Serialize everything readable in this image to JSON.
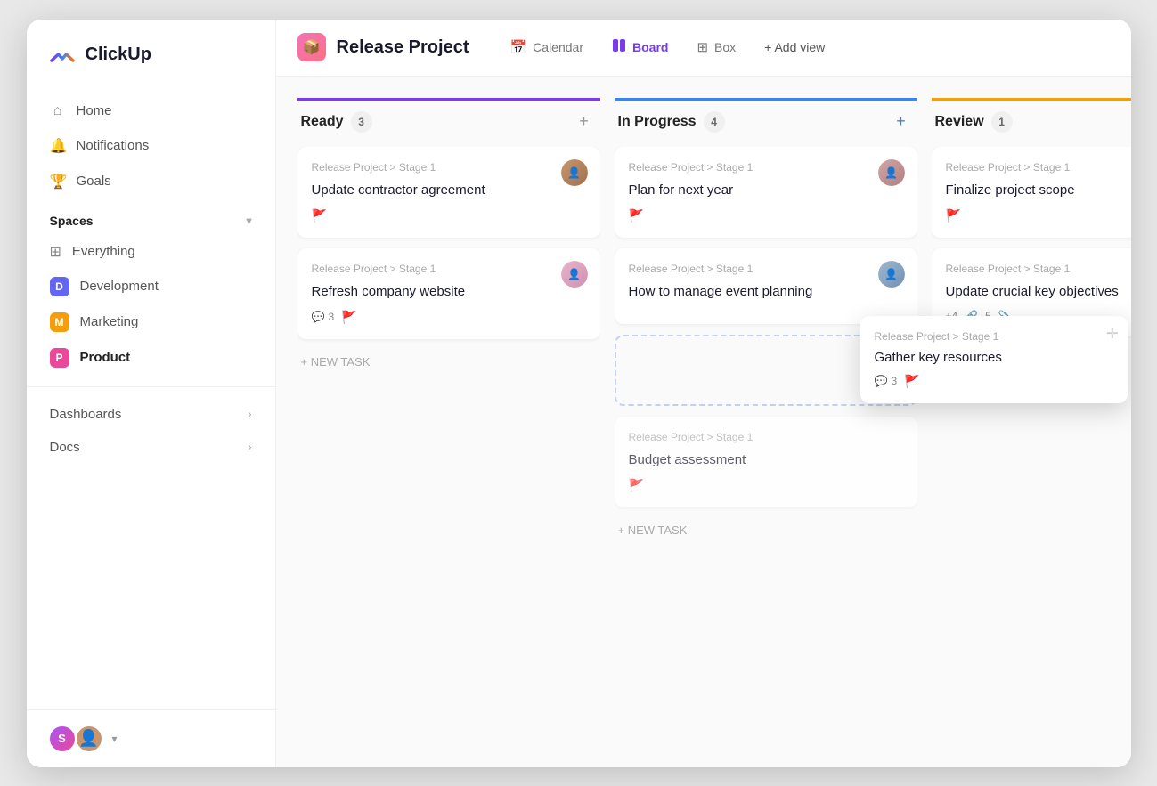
{
  "app": {
    "name": "ClickUp"
  },
  "sidebar": {
    "nav_items": [
      {
        "id": "home",
        "label": "Home",
        "icon": "🏠"
      },
      {
        "id": "notifications",
        "label": "Notifications",
        "icon": "🔔"
      },
      {
        "id": "goals",
        "label": "Goals",
        "icon": "🏆"
      }
    ],
    "spaces_title": "Spaces",
    "spaces": [
      {
        "id": "everything",
        "label": "Everything",
        "type": "everything"
      },
      {
        "id": "development",
        "label": "Development",
        "color": "#6366f1",
        "letter": "D"
      },
      {
        "id": "marketing",
        "label": "Marketing",
        "color": "#f59e0b",
        "letter": "M"
      },
      {
        "id": "product",
        "label": "Product",
        "color": "#ec4899",
        "letter": "P",
        "active": true
      }
    ],
    "collapse_items": [
      {
        "id": "dashboards",
        "label": "Dashboards"
      },
      {
        "id": "docs",
        "label": "Docs"
      }
    ]
  },
  "topbar": {
    "project_icon": "📦",
    "project_title": "Release Project",
    "tabs": [
      {
        "id": "calendar",
        "label": "Calendar",
        "icon": "📅",
        "active": false
      },
      {
        "id": "board",
        "label": "Board",
        "icon": "⬛",
        "active": true
      },
      {
        "id": "box",
        "label": "Box",
        "icon": "⊞",
        "active": false
      }
    ],
    "add_view_label": "+ Add view"
  },
  "columns": [
    {
      "id": "ready",
      "title": "Ready",
      "count": 3,
      "color_class": "ready",
      "add_btn": "+",
      "cards": [
        {
          "id": "card-1",
          "meta": "Release Project > Stage 1",
          "title": "Update contractor agreement",
          "avatar_color": "#c8956c",
          "avatar_letter": "A",
          "footer": {
            "flag": "orange"
          }
        },
        {
          "id": "card-2",
          "meta": "Release Project > Stage 1",
          "title": "Refresh company website",
          "avatar_color": "#d4a5c0",
          "avatar_letter": "B",
          "footer": {
            "comments": 3,
            "flag": "green"
          }
        }
      ],
      "new_task_label": "+ NEW TASK"
    },
    {
      "id": "in-progress",
      "title": "In Progress",
      "count": 4,
      "color_class": "in-progress",
      "add_btn": "+",
      "cards": [
        {
          "id": "card-3",
          "meta": "Release Project > Stage 1",
          "title": "Plan for next year",
          "avatar_color": "#d4a5a5",
          "avatar_letter": "C",
          "footer": {
            "flag": "red"
          }
        },
        {
          "id": "card-4",
          "meta": "Release Project > Stage 1",
          "title": "How to manage event planning",
          "avatar_color": "#a0b8d0",
          "avatar_letter": "D",
          "placeholder": false
        },
        {
          "id": "card-placeholder",
          "placeholder": true
        },
        {
          "id": "card-5",
          "meta": "Release Project > Stage 1",
          "title": "Budget assessment",
          "avatar_color": null,
          "footer": {
            "flag": "orange"
          }
        }
      ],
      "new_task_label": "+ NEW TASK"
    },
    {
      "id": "review",
      "title": "Review",
      "count": 1,
      "color_class": "review",
      "add_btn": "+",
      "cards": [
        {
          "id": "card-6",
          "meta": "Release Project > Stage 1",
          "title": "Finalize project scope",
          "avatar_color": "#d4b896",
          "avatar_letter": "E",
          "footer": {
            "flag": "red"
          }
        },
        {
          "id": "card-7",
          "meta": "Release Project > Stage 1",
          "title": "Update crucial key objectives",
          "avatar_color": null,
          "footer": {
            "extra": "+4",
            "attachments1": "🔗",
            "attachments2": "5 📎"
          }
        }
      ]
    }
  ],
  "floating_card": {
    "meta": "Release Project > Stage 1",
    "title": "Gather key resources",
    "comments": 3,
    "flag": "green"
  },
  "colors": {
    "purple": "#7c3aed",
    "blue": "#3b82f6",
    "yellow": "#f59e0b",
    "orange": "#f97316",
    "green": "#22c55e",
    "red": "#ef4444"
  }
}
